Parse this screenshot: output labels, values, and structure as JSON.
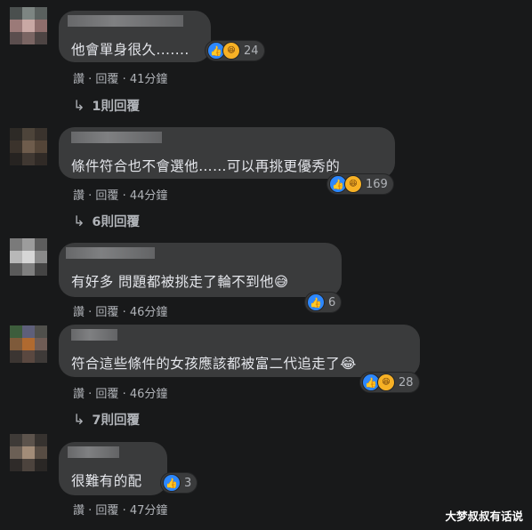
{
  "comments": [
    {
      "text": "他會單身很久.......",
      "reaction_count": "24",
      "reaction_icons": [
        "like-icon",
        "haha-icon"
      ],
      "actions": {
        "like": "讚",
        "reply": "回覆",
        "time": "41分鐘"
      },
      "replies_label": "1則回覆"
    },
    {
      "text": "條件符合也不會選他……可以再挑更優秀的",
      "reaction_count": "169",
      "reaction_icons": [
        "like-icon",
        "haha-icon"
      ],
      "actions": {
        "like": "讚",
        "reply": "回覆",
        "time": "44分鐘"
      },
      "replies_label": "6則回覆"
    },
    {
      "text": "有好多 問題都被挑走了輪不到他😅",
      "reaction_count": "6",
      "reaction_icons": [
        "like-icon"
      ],
      "actions": {
        "like": "讚",
        "reply": "回覆",
        "time": "46分鐘"
      },
      "replies_label": ""
    },
    {
      "text": "符合這些條件的女孩應該都被富二代追走了😂",
      "reaction_count": "28",
      "reaction_icons": [
        "like-icon",
        "haha-icon"
      ],
      "actions": {
        "like": "讚",
        "reply": "回覆",
        "time": "46分鐘"
      },
      "replies_label": "7則回覆"
    },
    {
      "text": "很難有的配",
      "reaction_count": "3",
      "reaction_icons": [
        "like-icon"
      ],
      "actions": {
        "like": "讚",
        "reply": "回覆",
        "time": "47分鐘"
      },
      "replies_label": ""
    }
  ],
  "separator": "·",
  "watermark": "大梦叔叔有话说",
  "colors": {
    "background": "#18191a",
    "bubble": "#3a3b3c",
    "like": "#2d88ff",
    "haha": "#f7b125",
    "secondary_text": "#b0b3b8"
  }
}
